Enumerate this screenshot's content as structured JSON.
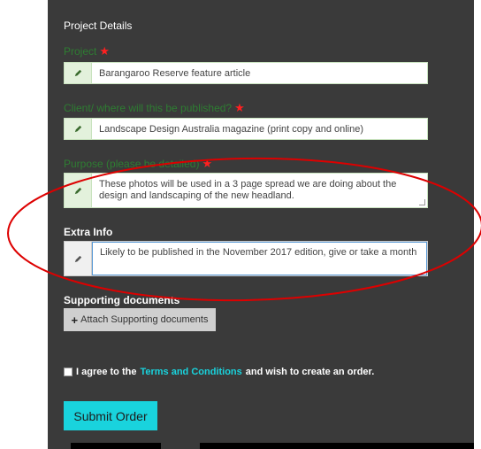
{
  "section": {
    "title": "Project Details"
  },
  "fields": {
    "project": {
      "label": "Project",
      "required_mark": "★",
      "value": "Barangaroo Reserve feature article"
    },
    "client": {
      "label": "Client/ where will this be published?",
      "required_mark": "★",
      "value": "Landscape Design Australia magazine (print copy and online)"
    },
    "purpose": {
      "label": "Purpose (please be detailed)",
      "required_mark": "★",
      "value": "These photos will be used in a 3 page spread we are doing about the design and landscaping of the new headland."
    },
    "extra": {
      "label": "Extra Info",
      "value": "Likely to be published in the November 2017 edition, give or take a month"
    }
  },
  "supporting": {
    "label": "Supporting documents",
    "button": "Attach Supporting documents",
    "button_icon": "plus-icon"
  },
  "agreement": {
    "prefix": "I agree to the",
    "link": "Terms and Conditions",
    "suffix": "and wish to create an order."
  },
  "submit": {
    "label": "Submit Order"
  },
  "colors": {
    "panel": "#3a3a3a",
    "accent": "#19d3dd",
    "label_green": "#2e7d32",
    "required": "#ff2020",
    "annotation": "#dd0000"
  },
  "icons": {
    "field_addon": "pencil-icon"
  }
}
